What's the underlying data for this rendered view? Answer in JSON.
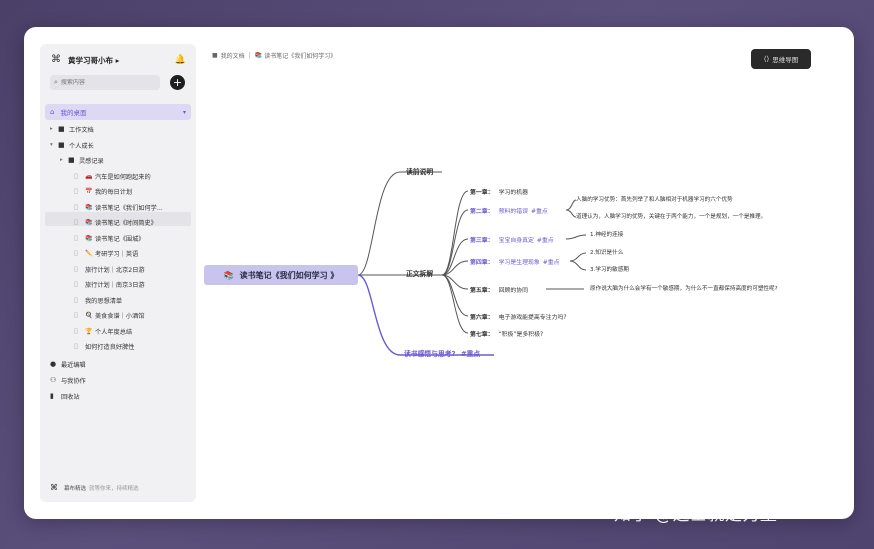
{
  "sidebar": {
    "workspace_name": "黄学习哥小布 ▸",
    "search_placeholder": "搜索内容",
    "nav_selected": "我的桌面",
    "tree": [
      {
        "label": "工作文档",
        "type": "folder",
        "arrow": "▸"
      },
      {
        "label": "个人成长",
        "type": "folder",
        "arrow": "▾"
      },
      {
        "label": "灵感记录",
        "type": "folder",
        "arrow": "▸"
      },
      {
        "label": "汽车是如何跑起来的",
        "type": "doc",
        "icon": "🚗"
      },
      {
        "label": "我的每日计划",
        "type": "doc",
        "icon": "📅"
      },
      {
        "label": "读书笔记《我们如何学...",
        "type": "doc",
        "icon": "📚"
      },
      {
        "label": "读书笔记《时间简史》",
        "type": "doc",
        "icon": "📚"
      },
      {
        "label": "读书笔记《围城》",
        "type": "doc",
        "icon": "📚"
      },
      {
        "label": "考研学习｜英语",
        "type": "doc",
        "icon": "✏️"
      },
      {
        "label": "旅行计划｜北京2日游",
        "type": "doc",
        "icon": ""
      },
      {
        "label": "旅行计划｜南京3日游",
        "type": "doc",
        "icon": ""
      },
      {
        "label": "我的思想清单",
        "type": "doc",
        "icon": ""
      },
      {
        "label": "美食食谱｜小酒馆",
        "type": "doc",
        "icon": "🍳"
      },
      {
        "label": "个人年度总结",
        "type": "doc",
        "icon": "🏆"
      },
      {
        "label": "如何打造良好脾性",
        "type": "doc",
        "icon": ""
      }
    ],
    "bottom_nav": [
      "最近编辑",
      "与我协作",
      "回收站"
    ],
    "footer_title": "幕布精选",
    "footer_sub": "就等你来，持续精选"
  },
  "breadcrumb": {
    "root": "我的文档",
    "current": "读书笔记《我们如何学习》"
  },
  "mode_button": "思维导图",
  "mindmap": {
    "root": "读书笔记《我们如何学习 》",
    "branches": [
      "读前说明",
      "正文拆解",
      "读书感悟与思考?"
    ],
    "branch_tags": [
      "",
      "",
      "#重点"
    ],
    "chapters": [
      {
        "label": "第一章：",
        "text": "学习的机器",
        "tag": ""
      },
      {
        "label": "第二章：",
        "text": "预料的错误",
        "tag": "#重点"
      },
      {
        "label": "第三章：",
        "text": "宝宝自身真定",
        "tag": "#重点"
      },
      {
        "label": "第四章：",
        "text": "学习是生理现象",
        "tag": "#重点"
      },
      {
        "label": "第五章：",
        "text": "回顾的协同",
        "tag": ""
      },
      {
        "label": "第六章：",
        "text": "电子游戏能提高专注力吗?",
        "tag": ""
      },
      {
        "label": "第七章：",
        "text": "“积极”是多积极?",
        "tag": ""
      }
    ],
    "leaves": [
      "人脑的学习优势：首先列举了和人脑相对于机器学习的六个优势",
      "道理认为，人脑学习的优势，关键在于两个能力，一个是规划，一个是推理。",
      "1.神经的连接",
      "2.知识是什么",
      "3.学习的敏感期",
      "原作说大脑为什么会学有一个敏感期，为什么不一直都保持高度的可塑性呢?"
    ]
  },
  "watermark": "知乎 @芝士就是力量",
  "colors": {
    "accent": "#6b5bd2",
    "node_bg": "#c9c4ee",
    "background": "#4e4470"
  }
}
